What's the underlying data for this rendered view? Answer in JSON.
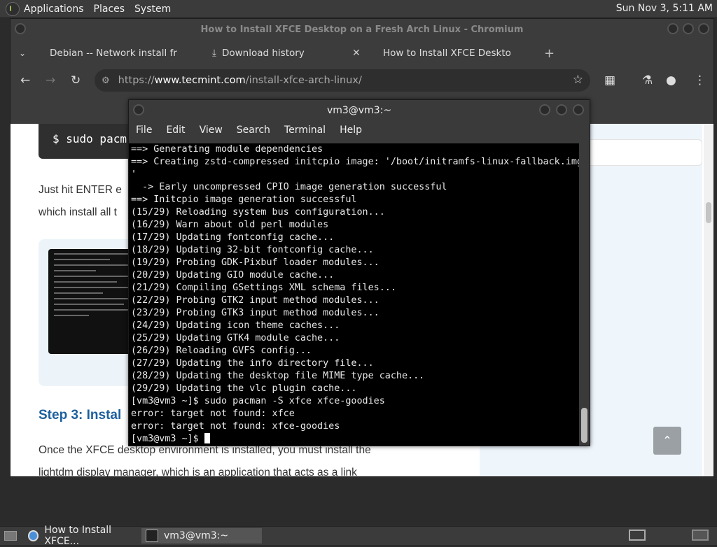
{
  "top_panel": {
    "menus": [
      "Applications",
      "Places",
      "System"
    ],
    "clock": "Sun Nov  3,  5:11 AM"
  },
  "browser": {
    "title": "How to Install XFCE Desktop on a Fresh Arch Linux - Chromium",
    "tabs": [
      {
        "label": "Debian -- Network install fro",
        "favicon": "debian-swirl-icon",
        "color": "#c70036"
      },
      {
        "label": "Download history",
        "favicon": "download-icon"
      },
      {
        "label": "How to Install XFCE Desktop",
        "favicon": "tecmint-icon",
        "color": "#4a7fc1"
      }
    ],
    "url_prefix": "https://",
    "url_host": "www.tecmint.com",
    "url_path": "/install-xfce-arch-linux/",
    "page": {
      "code_snippet": "$ sudo pacm",
      "paragraph1_line1": "Just hit ENTER e",
      "paragraph1_line2": "which install all t",
      "step_title": "Step 3: Instal",
      "paragraph2_line1": "Once the XFCE desktop environment is installed, you must install the",
      "paragraph2_line2": "lightdm display manager, which is an application that acts as a link"
    }
  },
  "terminal": {
    "title": "vm3@vm3:~",
    "menu": [
      "File",
      "Edit",
      "View",
      "Search",
      "Terminal",
      "Help"
    ],
    "lines": [
      "==> Generating module dependencies",
      "==> Creating zstd-compressed initcpio image: '/boot/initramfs-linux-fallback.img",
      "'",
      "  -> Early uncompressed CPIO image generation successful",
      "==> Initcpio image generation successful",
      "(15/29) Reloading system bus configuration...",
      "(16/29) Warn about old perl modules",
      "(17/29) Updating fontconfig cache...",
      "(18/29) Updating 32-bit fontconfig cache...",
      "(19/29) Probing GDK-Pixbuf loader modules...",
      "(20/29) Updating GIO module cache...",
      "(21/29) Compiling GSettings XML schema files...",
      "(22/29) Probing GTK2 input method modules...",
      "(23/29) Probing GTK3 input method modules...",
      "(24/29) Updating icon theme caches...",
      "(25/29) Updating GTK4 module cache...",
      "(26/29) Reloading GVFS config...",
      "(27/29) Updating the info directory file...",
      "(28/29) Updating the desktop file MIME type cache...",
      "(29/29) Updating the vlc plugin cache...",
      "[vm3@vm3 ~]$ sudo pacman -S xfce xfce-goodies",
      "error: target not found: xfce",
      "error: target not found: xfce-goodies"
    ],
    "prompt": "[vm3@vm3 ~]$ "
  },
  "taskbar": {
    "items": [
      {
        "label": "How to Install XFCE...",
        "icon": "chromium-icon"
      },
      {
        "label": "vm3@vm3:~",
        "icon": "terminal-icon"
      }
    ]
  }
}
